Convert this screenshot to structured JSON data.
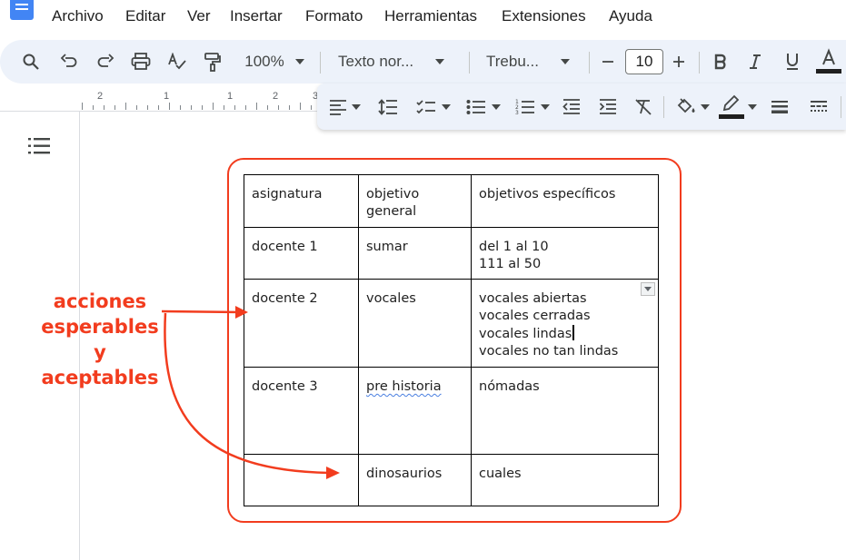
{
  "menu": {
    "items": [
      "Archivo",
      "Editar",
      "Ver",
      "Insertar",
      "Formato",
      "Herramientas",
      "Extensiones",
      "Ayuda"
    ]
  },
  "toolbar": {
    "zoom": "100%",
    "style": "Texto nor...",
    "font": "Trebu...",
    "font_size": "10",
    "icons": [
      "search-icon",
      "undo-icon",
      "redo-icon",
      "print-icon",
      "spellcheck-icon",
      "paint-format-icon",
      "minus-icon",
      "plus-icon",
      "bold-icon",
      "italic-icon",
      "underline-icon",
      "text-color-icon"
    ]
  },
  "ruler": {
    "numbers": [
      "2",
      "1",
      "1",
      "2",
      "3"
    ]
  },
  "overflow_toolbar": {
    "icons": [
      "align-left-icon",
      "line-spacing-icon",
      "checklist-icon",
      "bulleted-list-icon",
      "numbered-list-icon",
      "decrease-indent-icon",
      "increase-indent-icon",
      "clear-formatting-icon",
      "fill-color-icon",
      "border-color-icon",
      "border-width-icon",
      "border-dash-icon"
    ]
  },
  "table": {
    "rows": [
      [
        [
          "asignatura"
        ],
        [
          "objetivo",
          "general"
        ],
        [
          "objetivos específicos"
        ]
      ],
      [
        [
          "docente 1"
        ],
        [
          "sumar"
        ],
        [
          "del 1 al 10",
          "111 al 50"
        ]
      ],
      [
        [
          "docente 2"
        ],
        [
          "vocales"
        ],
        [
          "vocales abiertas",
          "vocales cerradas",
          "vocales lindas",
          "vocales no tan lindas"
        ]
      ],
      [
        [
          "docente 3"
        ],
        [
          "pre historia"
        ],
        [
          "nómadas"
        ]
      ],
      [
        [
          ""
        ],
        [
          "dinosaurios"
        ],
        [
          "cuales"
        ]
      ]
    ]
  },
  "annotation": {
    "lines": [
      "acciones",
      "esperables",
      "y",
      "aceptables"
    ],
    "color": "#f23c1e"
  },
  "colors": {
    "toolbar_bg": "#edf2fa",
    "brand_blue": "#4285f4",
    "annotation_red": "#f23c1e"
  }
}
